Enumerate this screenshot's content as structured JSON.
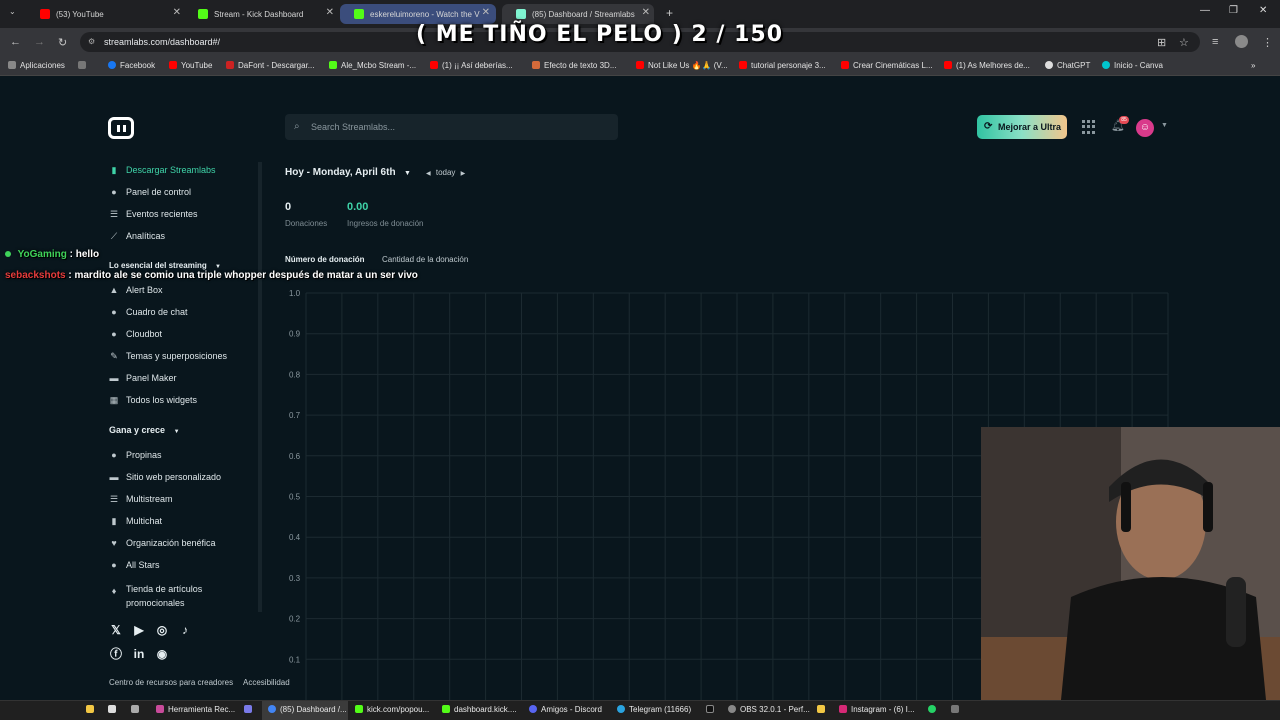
{
  "browser": {
    "tabs": [
      {
        "label": "(53) YouTube",
        "color": "#ff0000"
      },
      {
        "label": "Stream - Kick Dashboard",
        "color": "#53fc18"
      },
      {
        "label": "eskereluimoreno - Watch the V",
        "color": "#53fc18"
      },
      {
        "label": "(85) Dashboard / Streamlabs",
        "color": "#80f5d2"
      }
    ],
    "url": "streamlabs.com/dashboard#/",
    "bookmarks": [
      {
        "label": "Aplicaciones",
        "color": "#888888"
      },
      {
        "label": "Facebook",
        "color": "#1877f2"
      },
      {
        "label": "YouTube",
        "color": "#ff0000"
      },
      {
        "label": "DaFont - Descargar...",
        "color": "#cc2222"
      },
      {
        "label": "Ale_Mcbo Stream -...",
        "color": "#53fc18"
      },
      {
        "label": "(1) ¡¡ Así deberías...",
        "color": "#ff0000"
      },
      {
        "label": "Efecto de texto 3D...",
        "color": "#d36a3a"
      },
      {
        "label": "Not Like Us 🔥🙏 (V...",
        "color": "#ff0000"
      },
      {
        "label": "tutorial personaje 3...",
        "color": "#ff0000"
      },
      {
        "label": "Crear Cinemáticas L...",
        "color": "#ff0000"
      },
      {
        "label": "(1) As Melhores de...",
        "color": "#ff0000"
      },
      {
        "label": "ChatGPT",
        "color": "#dddddd"
      },
      {
        "label": "Inicio - Canva",
        "color": "#00c4cc"
      }
    ]
  },
  "overlay": {
    "title": "( ME TIÑO EL PELO ) 2 / 150"
  },
  "header": {
    "search_placeholder": "Search Streamlabs...",
    "ultra_label": "Mejorar a Ultra",
    "notif_count": "85"
  },
  "sidebar": {
    "top_items": [
      {
        "label": "Descargar Streamlabs",
        "icon": "download-icon"
      },
      {
        "label": "Panel de control",
        "icon": "dashboard-icon"
      },
      {
        "label": "Eventos recientes",
        "icon": "list-icon"
      },
      {
        "label": "Analíticas",
        "icon": "analytics-icon"
      }
    ],
    "essentials_title": "Lo esencial del streaming",
    "essentials": [
      {
        "label": "Alert Box",
        "icon": "bell-icon"
      },
      {
        "label": "Cuadro de chat",
        "icon": "chat-icon"
      },
      {
        "label": "Cloudbot",
        "icon": "bot-icon"
      },
      {
        "label": "Temas y superposiciones",
        "icon": "brush-icon"
      },
      {
        "label": "Panel Maker",
        "icon": "panel-icon"
      },
      {
        "label": "Todos los widgets",
        "icon": "grid-icon"
      }
    ],
    "grow_title": "Gana y crece",
    "grow": [
      {
        "label": "Propinas",
        "icon": "tip-icon"
      },
      {
        "label": "Sitio web personalizado",
        "icon": "web-icon"
      },
      {
        "label": "Multistream",
        "icon": "multistream-icon"
      },
      {
        "label": "Multichat",
        "icon": "multichat-icon"
      },
      {
        "label": "Organización benéfica",
        "icon": "heart-icon"
      },
      {
        "label": "All Stars",
        "icon": "star-icon"
      },
      {
        "label": "Tienda de artículos",
        "icon": "shirt-icon"
      }
    ],
    "grow_last_line2": "promocionales",
    "footer": [
      "Centro de recursos para creadores",
      "Accesibilidad"
    ]
  },
  "main": {
    "date_label": "Hoy - Monday, April 6th",
    "today_label": "today",
    "stats": [
      {
        "value": "0",
        "label": "Donaciones",
        "color": "#e6eef1"
      },
      {
        "value": "0.00",
        "label": "Ingresos de donación",
        "color": "#3fd3a8"
      }
    ],
    "chart_tabs": [
      "Número de donación",
      "Cantidad de la donación"
    ]
  },
  "chart_data": {
    "type": "bar",
    "categories": [],
    "values": [],
    "title": "",
    "ylim": [
      0,
      1.0
    ],
    "yticks": [
      "1.0",
      "0.9",
      "0.8",
      "0.7",
      "0.6",
      "0.5",
      "0.4",
      "0.3",
      "0.2",
      "0.1"
    ],
    "grid": true
  },
  "chat": [
    {
      "user": "YoGaming",
      "message": ": hello",
      "user_color": "#3fd35a"
    },
    {
      "user": "sebackshots",
      "message": ": mardito ale se comio una triple whopper después de matar a un ser vivo",
      "user_color": "#e63c3c"
    }
  ],
  "taskbar": [
    {
      "label": "Herramienta Rec...",
      "color": "#c94b9a"
    },
    {
      "label": "(85) Dashboard /...",
      "color": "#4285f4"
    },
    {
      "label": "kick.com/popou...",
      "color": "#53fc18"
    },
    {
      "label": "dashboard.kick....",
      "color": "#53fc18"
    },
    {
      "label": "Amigos - Discord",
      "color": "#5865f2"
    },
    {
      "label": "Telegram (11666)",
      "color": "#2aa3df"
    },
    {
      "label": "OBS 32.0.1 - Perf...",
      "color": "#888888"
    },
    {
      "label": "Instagram - (6) I...",
      "color": "#d62976"
    }
  ]
}
